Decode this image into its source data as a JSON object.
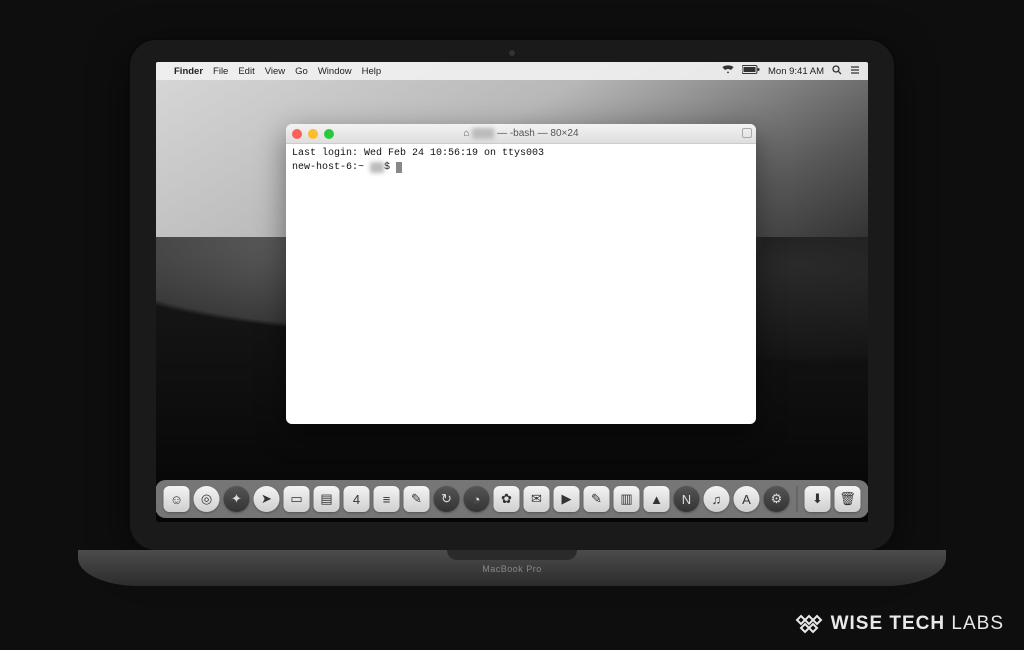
{
  "menubar": {
    "app": "Finder",
    "items": [
      "File",
      "Edit",
      "View",
      "Go",
      "Window",
      "Help"
    ],
    "clock": "Mon 9:41 AM"
  },
  "terminal": {
    "title_prefix": "⌂",
    "title_user_hidden": "——",
    "title_suffix": "— -bash — 80×24",
    "line1": "Last login: Wed Feb 24 10:56:19 on ttys003",
    "prompt_host": "new-host-6:~",
    "prompt_user_hidden": "——",
    "prompt_symbol": "$"
  },
  "dock": {
    "items": [
      {
        "name": "finder",
        "glyph": "☺",
        "style": "light"
      },
      {
        "name": "safari",
        "glyph": "◎",
        "style": "light round"
      },
      {
        "name": "launchpad",
        "glyph": "✦",
        "style": "dark round"
      },
      {
        "name": "compass",
        "glyph": "➤",
        "style": "light round"
      },
      {
        "name": "contacts",
        "glyph": "▭",
        "style": "light"
      },
      {
        "name": "notes",
        "glyph": "▤",
        "style": "light"
      },
      {
        "name": "calendar",
        "glyph": "4",
        "style": "light"
      },
      {
        "name": "reminders",
        "glyph": "≡",
        "style": "light"
      },
      {
        "name": "textedit",
        "glyph": "✎",
        "style": "light"
      },
      {
        "name": "time-machine",
        "glyph": "↻",
        "style": "dark round"
      },
      {
        "name": "clock",
        "glyph": "◔",
        "style": "dark round"
      },
      {
        "name": "photos",
        "glyph": "✿",
        "style": "light"
      },
      {
        "name": "messages",
        "glyph": "✉",
        "style": "light"
      },
      {
        "name": "facetime",
        "glyph": "▶",
        "style": "light"
      },
      {
        "name": "pages",
        "glyph": "✎",
        "style": "light"
      },
      {
        "name": "numbers",
        "glyph": "▥",
        "style": "light"
      },
      {
        "name": "keynote",
        "glyph": "▲",
        "style": "light"
      },
      {
        "name": "news",
        "glyph": "N",
        "style": "dark round"
      },
      {
        "name": "itunes",
        "glyph": "♫",
        "style": "light round"
      },
      {
        "name": "appstore",
        "glyph": "A",
        "style": "light round"
      },
      {
        "name": "settings",
        "glyph": "⚙",
        "style": "dark round"
      }
    ],
    "after_sep": [
      {
        "name": "downloads",
        "glyph": "⬇",
        "style": "light"
      },
      {
        "name": "trash",
        "glyph": "🗑",
        "style": "light"
      }
    ]
  },
  "laptop_label": "MacBook Pro",
  "watermark": {
    "brand1": "WISE TECH",
    "brand2": "LABS"
  }
}
